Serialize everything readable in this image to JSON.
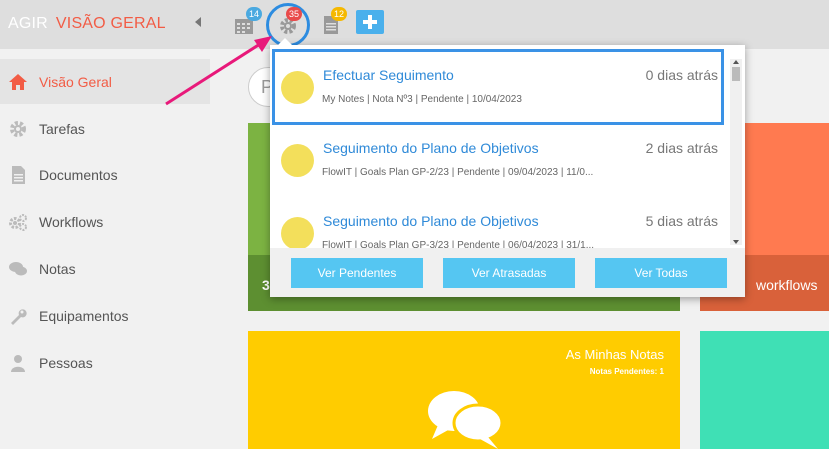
{
  "header": {
    "brand": "AGIR",
    "page": "VISÃO GERAL",
    "badges": {
      "calendar": "14",
      "settings": "35",
      "documents": "12"
    }
  },
  "sidebar": {
    "items": [
      {
        "label": "Visão Geral",
        "icon": "home-icon"
      },
      {
        "label": "Tarefas",
        "icon": "gear-icon"
      },
      {
        "label": "Documentos",
        "icon": "document-icon"
      },
      {
        "label": "Workflows",
        "icon": "gears-icon"
      },
      {
        "label": "Notas",
        "icon": "chat-icon"
      },
      {
        "label": "Equipamentos",
        "icon": "wrench-icon"
      },
      {
        "label": "Pessoas",
        "icon": "person-icon"
      }
    ]
  },
  "main": {
    "search_fragment": "P",
    "green_tile_number": "3",
    "orange_tile_label": "workflows",
    "yellow_tile": {
      "title": "As Minhas Notas",
      "subtitle": "Notas Pendentes: 1"
    }
  },
  "notifications": {
    "items": [
      {
        "title": "Efectuar Seguimento",
        "time": "0 dias atrás",
        "meta": "My Notes | Nota Nº3 | Pendente | 10/04/2023"
      },
      {
        "title": "Seguimento do Plano de Objetivos",
        "time": "2 dias atrás",
        "meta": "FlowIT | Goals Plan GP-2/23 | Pendente | 09/04/2023 | 11/0..."
      },
      {
        "title": "Seguimento do Plano de Objetivos",
        "time": "5 dias atrás",
        "meta": "FlowIT | Goals Plan GP-3/23 | Pendente | 06/04/2023 | 31/1..."
      }
    ],
    "buttons": {
      "pending": "Ver Pendentes",
      "overdue": "Ver Atrasadas",
      "all": "Ver Todas"
    }
  },
  "colors": {
    "accent": "#f25c45",
    "link": "#2f8ad8",
    "button": "#55c6f2",
    "highlight": "#3a92e6",
    "arrow": "#e8197a"
  }
}
